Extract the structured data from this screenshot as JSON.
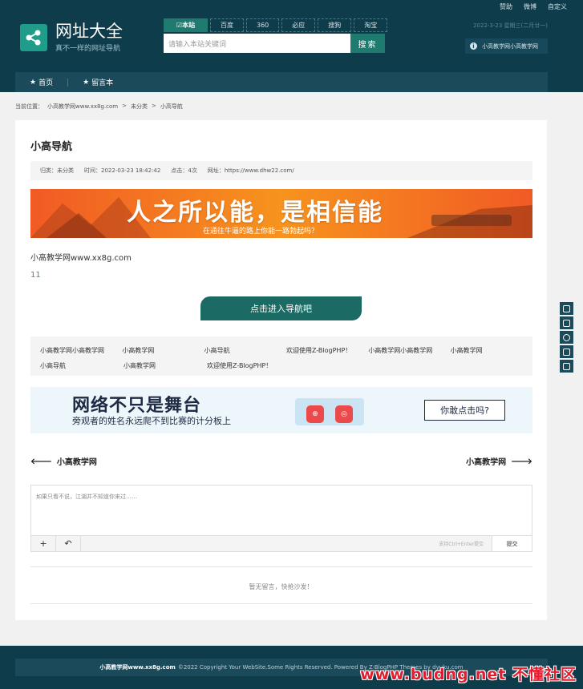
{
  "header": {
    "top_links": [
      "赞助",
      "微博",
      "自定义"
    ],
    "logo_title": "网址大全",
    "logo_subtitle": "真不一样的网址导航",
    "search_tabs": [
      "本站",
      "百度",
      "360",
      "必应",
      "搜狗",
      "淘宝"
    ],
    "search_placeholder": "请输入本站关键词",
    "search_button": "搜索",
    "date": "2022-3-23 星期三(二月廿一)",
    "notice": "小高教学网小高教学网"
  },
  "nav": {
    "items": [
      "首页",
      "留言本"
    ]
  },
  "breadcrumb": {
    "label": "当前位置：",
    "items": [
      "小高教学网www.xx8g.com",
      ">",
      "未分类",
      ">",
      "小高导航"
    ]
  },
  "article": {
    "title": "小高导航",
    "meta": {
      "category": "归类：未分类",
      "time": "时间：2022-03-23 18:42:42",
      "clicks": "点击：4次",
      "url": "网址：https://www.dhw22.com/"
    },
    "banner1_big": "人之所以能，是相信能",
    "banner1_small": "在通往牛逼的路上你能一路勃起吗？",
    "body_text": "小高教学网www.xx8g.com",
    "body_number": "11",
    "nav_button": "点击进入导航吧",
    "links": [
      [
        "小高教学网小高教学网",
        "小高教学网",
        "小高导航",
        "欢迎使用Z-BlogPHP！",
        "小高教学网小高教学网",
        "小高教学网"
      ],
      [
        "小高导航",
        "小高教学网",
        "欢迎使用Z-BlogPHP！"
      ]
    ],
    "banner2_big": "网络不只是舞台",
    "banner2_small": "旁观者的姓名永远爬不到比赛的计分板上",
    "banner2_button": "你敢点击吗?",
    "prev": "小高教学网",
    "next": "小高教学网"
  },
  "comment": {
    "placeholder": "如果只看不说，江湖并不知道你来过……",
    "hint": "支持Ctrl+Enter提交",
    "submit": "提交",
    "empty": "暂无留言，快抢沙发！"
  },
  "footer": {
    "site": "小高教学网www.xx8g.com",
    "copyright": "©2022 Copyright Your WebSite.Some Rights Reserved. Powered By Z-BlogPHP Themes by dyuku.com"
  },
  "watermark": "www.budng.net 不懂社区"
}
